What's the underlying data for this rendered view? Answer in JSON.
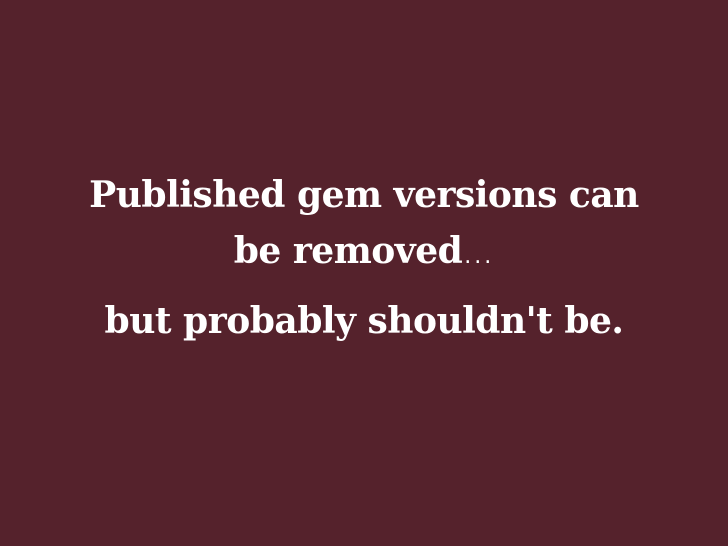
{
  "slide": {
    "background_color": "#55222c",
    "text_color": "#ffffff",
    "heading_line_1": "Published gem versions can",
    "heading_line_2": "be removed",
    "heading_trailing_ellipsis": "...",
    "followup_line": "but probably shouldn't be."
  }
}
